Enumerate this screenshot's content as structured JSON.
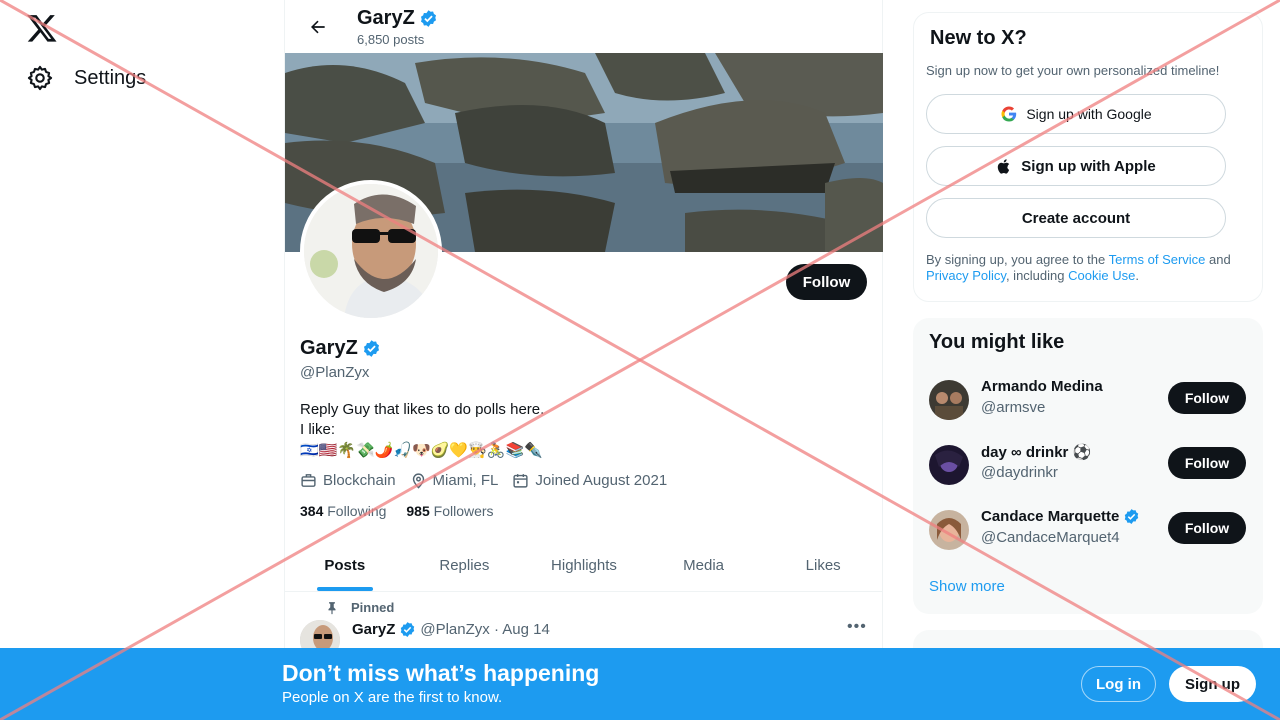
{
  "nav": {
    "settings_label": "Settings"
  },
  "header": {
    "name": "GaryZ",
    "post_count": "6,850 posts"
  },
  "profile": {
    "name": "GaryZ",
    "handle": "@PlanZyx",
    "bio_line1": "Reply Guy that likes to do polls here.",
    "bio_line2": "I like:",
    "bio_emojis": "🇮🇱🇺🇸🌴💸🌶️🎣🐶🥑💛👨‍🍳🚴📚✒️",
    "follow_label": "Follow",
    "category": "Blockchain",
    "location": "Miami, FL",
    "joined": "Joined August 2021",
    "following_count": "384",
    "following_label": "Following",
    "followers_count": "985",
    "followers_label": "Followers"
  },
  "tabs": [
    {
      "label": "Posts",
      "active": true
    },
    {
      "label": "Replies"
    },
    {
      "label": "Highlights"
    },
    {
      "label": "Media"
    },
    {
      "label": "Likes"
    }
  ],
  "pinned_tweet": {
    "pinned_label": "Pinned",
    "name": "GaryZ",
    "handle_date": "@PlanZyx · Aug 14"
  },
  "new_to_x": {
    "title": "New to X?",
    "subtitle": "Sign up now to get your own personalized timeline!",
    "google_label": "Sign up with Google",
    "apple_label": "Sign up with Apple",
    "create_label": "Create account",
    "legal_prefix": "By signing up, you agree to the ",
    "terms_link": "Terms of Service",
    "legal_and": " and ",
    "privacy_link": "Privacy Policy",
    "legal_including": ", including ",
    "cookie_link": "Cookie Use",
    "legal_end": "."
  },
  "you_might_like": {
    "title": "You might like",
    "suggestions": [
      {
        "name": "Armando Medina",
        "handle": "@armsve",
        "button": "Follow",
        "verified": false
      },
      {
        "name": "day ∞ drinkr ⚽",
        "handle": "@daydrinkr",
        "button": "Follow",
        "verified": false
      },
      {
        "name": "Candace Marquette",
        "handle": "@CandaceMarquet4",
        "button": "Follow",
        "verified": true
      }
    ],
    "show_more": "Show more"
  },
  "bottom_bar": {
    "title": "Don’t miss what’s happening",
    "subtitle": "People on X are the first to know.",
    "login_label": "Log in",
    "signup_label": "Sign up"
  },
  "colors": {
    "accent": "#1d9bf0",
    "text": "#0f1419",
    "muted": "#536471",
    "overlay_cross": "#f08080"
  },
  "icons": [
    "x-logo-icon",
    "gear-icon",
    "back-arrow-icon",
    "verified-badge-icon",
    "briefcase-icon",
    "location-pin-icon",
    "calendar-icon",
    "pin-icon",
    "more-icon",
    "google-icon",
    "apple-icon"
  ]
}
